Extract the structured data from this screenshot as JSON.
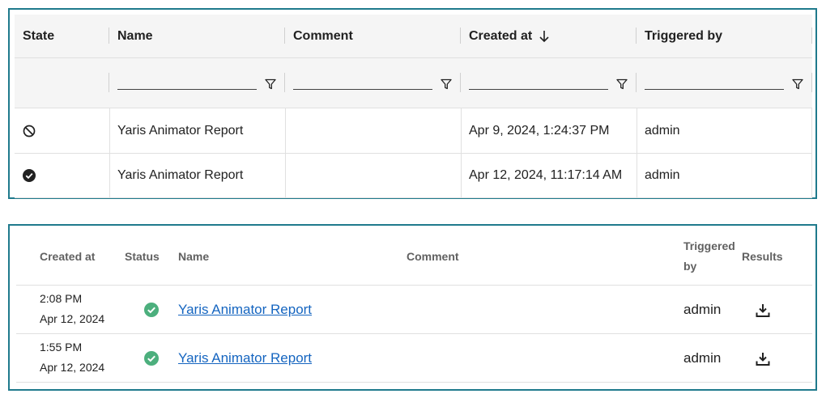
{
  "grid": {
    "columns": {
      "state": "State",
      "name": "Name",
      "comment": "Comment",
      "created_at": "Created at",
      "triggered_by": "Triggered by"
    },
    "sort_indicator": "arrow-down-icon",
    "filters": {
      "name": "",
      "comment": "",
      "created_at": "",
      "triggered_by": ""
    },
    "rows": [
      {
        "state_icon": "blocked-icon",
        "name": "Yaris Animator Report",
        "comment": "",
        "created_at": "Apr 9, 2024, 1:24:37 PM",
        "triggered_by": "admin"
      },
      {
        "state_icon": "check-circle-icon",
        "name": "Yaris Animator Report",
        "comment": "",
        "created_at": "Apr 12, 2024, 11:17:14 AM",
        "triggered_by": "admin"
      }
    ]
  },
  "list": {
    "columns": {
      "created_at": "Created at",
      "status": "Status",
      "name": "Name",
      "comment": "Comment",
      "triggered_by_line1": "Triggered",
      "triggered_by_line2": "by",
      "results": "Results"
    },
    "rows": [
      {
        "time": "2:08 PM",
        "date": "Apr 12, 2024",
        "status_icon": "check-circle-icon",
        "name": "Yaris Animator Report",
        "comment": "",
        "triggered_by": "admin",
        "results_icon": "download-icon"
      },
      {
        "time": "1:55 PM",
        "date": "Apr 12, 2024",
        "status_icon": "check-circle-icon",
        "name": "Yaris Animator Report",
        "comment": "",
        "triggered_by": "admin",
        "results_icon": "download-icon"
      }
    ]
  },
  "colors": {
    "panel_border": "#1f7a8c",
    "success_green": "#4caf7d",
    "link_blue": "#1565c0"
  }
}
